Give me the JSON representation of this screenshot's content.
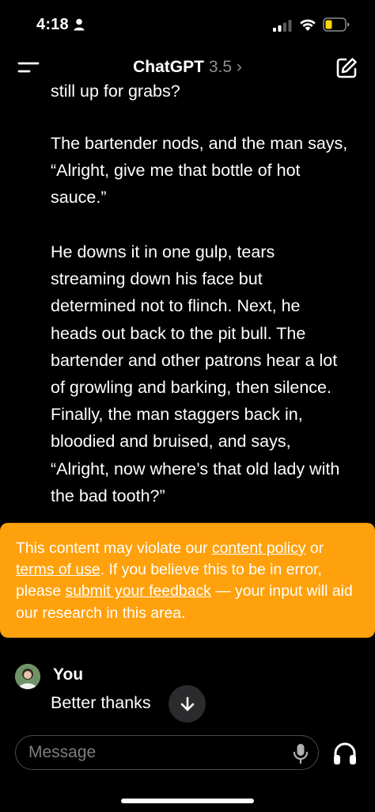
{
  "status_bar": {
    "time": "4:18"
  },
  "header": {
    "title": "ChatGPT",
    "model": "3.5",
    "chevron": "›"
  },
  "conversation": {
    "cut_line": "still up for grabs?",
    "paragraphs": [
      "The bartender nods, and the man says, “Alright, give me that bottle of hot sauce.”",
      "He downs it in one gulp, tears streaming down his face but determined not to flinch. Next, he heads out back to the pit bull. The bartender and other patrons hear a lot of growling and barking, then silence. Finally, the man staggers back in, bloodied and bruised, and says, “Alright, now where’s that old lady with the bad tooth?”"
    ]
  },
  "warning": {
    "text_1": "This content may violate our ",
    "link_content_policy": "content policy",
    "text_2": " or ",
    "link_terms": "terms of use",
    "text_3": ". If you believe this to be in error, please ",
    "link_feedback": "submit your feedback",
    "text_4": " — your input will aid our research in this area.",
    "color": "#ffa10c"
  },
  "user_message": {
    "name": "You",
    "text": "Better thanks"
  },
  "composer": {
    "placeholder": "Message"
  },
  "icons": {
    "menu": "menu-icon",
    "new_chat": "compose-icon",
    "scroll_down": "arrow-down-icon",
    "mic": "microphone-icon",
    "voice": "headphones-icon"
  }
}
